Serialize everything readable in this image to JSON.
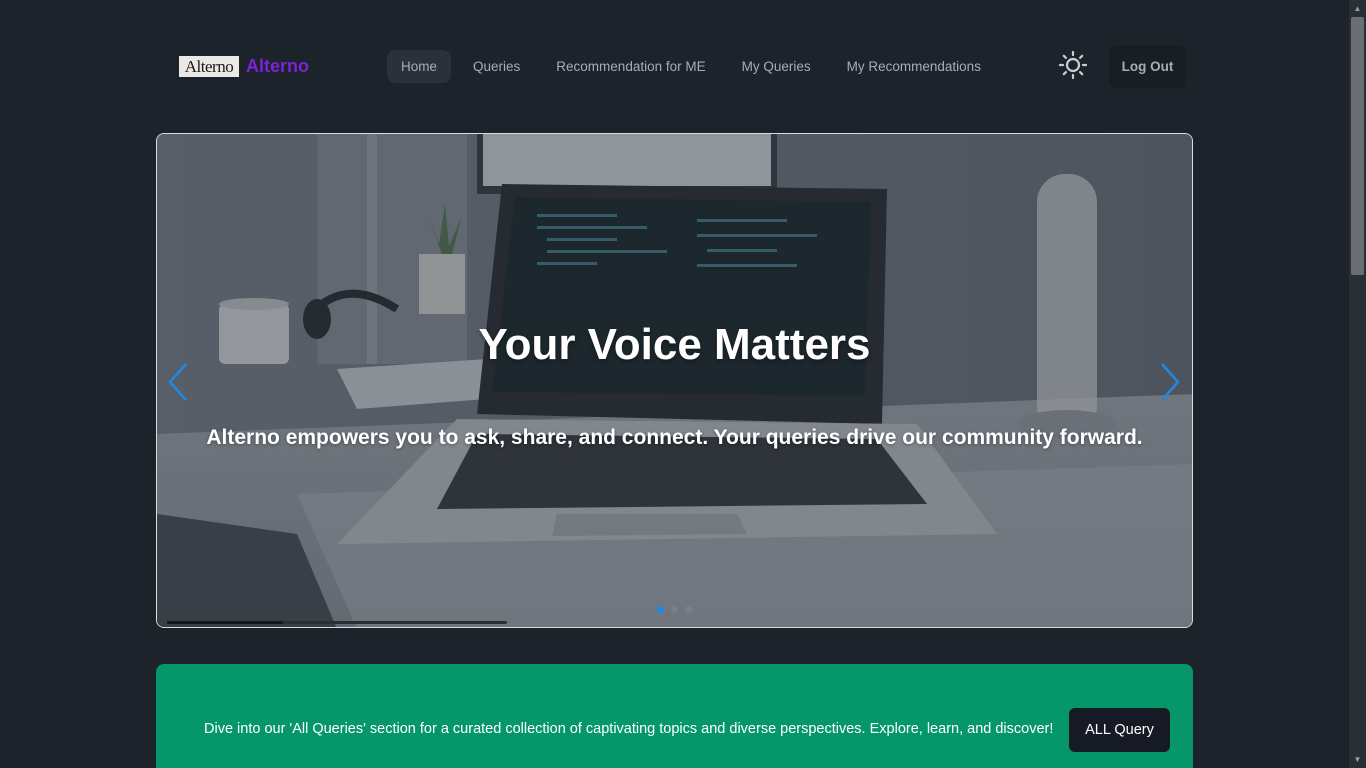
{
  "brand": {
    "logo_text": "Alterno",
    "name": "Alterno"
  },
  "nav": {
    "items": [
      {
        "label": "Home",
        "active": true
      },
      {
        "label": "Queries",
        "active": false
      },
      {
        "label": "Recommendation for ME",
        "active": false
      },
      {
        "label": "My Queries",
        "active": false
      },
      {
        "label": "My Recommendations",
        "active": false
      }
    ],
    "theme_toggle_icon": "sun-icon",
    "logout_label": "Log Out"
  },
  "carousel": {
    "title": "Your Voice Matters",
    "subtitle": "Alterno empowers you to ask, share, and connect. Your queries drive our community forward.",
    "slide_count": 3,
    "active_slide": 1,
    "autoplay_progress": 0.34
  },
  "banner": {
    "text": "Dive into our 'All Queries' section for a curated collection of captivating topics and diverse perspectives. Explore, learn, and discover!",
    "button_label": "ALL Query"
  },
  "colors": {
    "background": "#1d232a",
    "brand": "#7c22d8",
    "banner": "#05976a",
    "carousel_arrow": "#1e88e5"
  }
}
